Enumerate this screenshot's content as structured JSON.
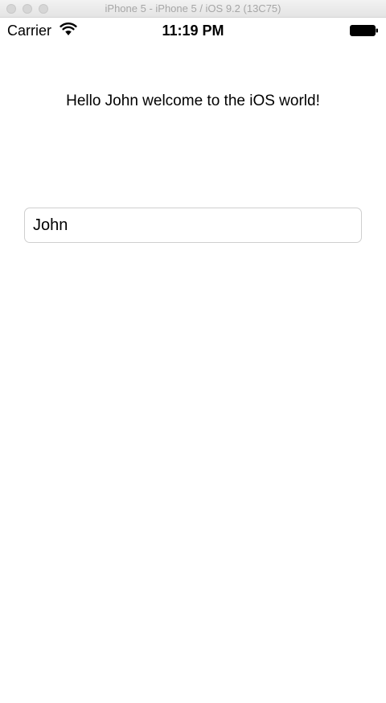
{
  "window": {
    "title": "iPhone 5 - iPhone 5 / iOS 9.2 (13C75)"
  },
  "status_bar": {
    "carrier": "Carrier",
    "time": "11:19 PM",
    "icons": [
      "wifi-icon",
      "battery-icon"
    ]
  },
  "main": {
    "greeting": "Hello John welcome to the iOS world!",
    "name_field": {
      "value": "John",
      "placeholder": ""
    }
  },
  "colors": {
    "background": "#ffffff",
    "text": "#000000",
    "field_border": "#cfcfcf",
    "titlebar_text": "#a6a6a6"
  }
}
